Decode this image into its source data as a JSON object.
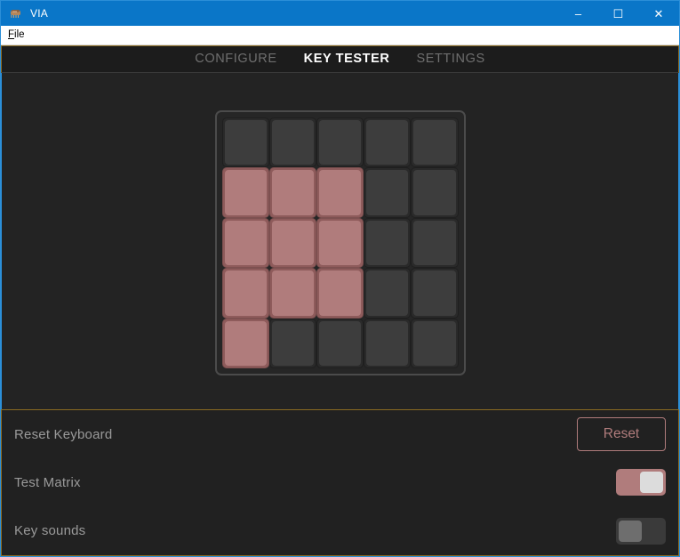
{
  "window": {
    "title": "VIA",
    "icon": "chip-icon",
    "controls": {
      "minimize": "–",
      "maximize": "☐",
      "close": "✕"
    }
  },
  "menubar": {
    "items": [
      {
        "label": "File",
        "accel": "F",
        "rest": "ile"
      }
    ]
  },
  "tabs": [
    {
      "label": "CONFIGURE",
      "active": false
    },
    {
      "label": "KEY TESTER",
      "active": true
    },
    {
      "label": "SETTINGS",
      "active": false
    }
  ],
  "key_matrix": {
    "rows": 5,
    "cols": 5,
    "pressed_color": "#b07c7c",
    "idle_color": "#3d3d3d",
    "grid": [
      [
        false,
        false,
        false,
        false,
        false
      ],
      [
        true,
        true,
        true,
        false,
        false
      ],
      [
        true,
        true,
        true,
        false,
        false
      ],
      [
        true,
        true,
        true,
        false,
        false
      ],
      [
        true,
        false,
        false,
        false,
        false
      ]
    ]
  },
  "settings": {
    "rows": [
      {
        "label": "Reset Keyboard",
        "control": "button",
        "button_label": "Reset",
        "accent": "#b07c7c"
      },
      {
        "label": "Test Matrix",
        "control": "toggle",
        "value": "on"
      },
      {
        "label": "Key sounds",
        "control": "toggle",
        "value": "off"
      }
    ]
  },
  "colors": {
    "titlebar": "#0a76c8",
    "accent": "#b07c7c",
    "panel_border": "#8a6a22",
    "frame_border": "#2b8fd8",
    "content_bg": "#232323"
  }
}
